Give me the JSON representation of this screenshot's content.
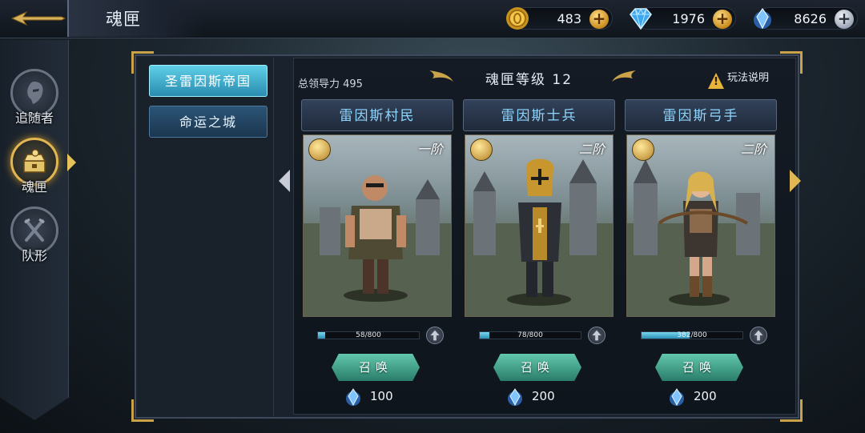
{
  "header": {
    "title": "魂匣",
    "resources": [
      {
        "icon": "gold-coin-icon",
        "value": "483"
      },
      {
        "icon": "diamond-icon",
        "value": "1976"
      },
      {
        "icon": "soul-crystal-icon",
        "value": "8626"
      }
    ]
  },
  "sidebar": {
    "items": [
      {
        "label": "追随者",
        "icon": "follower-icon",
        "active": false
      },
      {
        "label": "魂匣",
        "icon": "soul-box-icon",
        "active": true
      },
      {
        "label": "队形",
        "icon": "formation-icon",
        "active": false
      }
    ]
  },
  "categories": [
    {
      "label": "圣雷因斯帝国",
      "active": true
    },
    {
      "label": "命运之城",
      "active": false
    }
  ],
  "panel": {
    "leadership": "总领导力 495",
    "level_title": "魂匣等级 12",
    "help_label": "玩法说明"
  },
  "units": [
    {
      "name": "雷因斯村民",
      "rank": "一阶",
      "progress_text": "58/800",
      "progress": 0.0725,
      "summon_label": "召唤",
      "cost": "100"
    },
    {
      "name": "雷因斯士兵",
      "rank": "二阶",
      "progress_text": "78/800",
      "progress": 0.0975,
      "summon_label": "召唤",
      "cost": "200"
    },
    {
      "name": "雷因斯弓手",
      "rank": "二阶",
      "progress_text": "382/800",
      "progress": 0.4775,
      "summon_label": "召唤",
      "cost": "200"
    }
  ],
  "colors": {
    "accent_gold": "#e2b653",
    "active_tab": "#5fd0e8",
    "summon_button": "#3f9c86",
    "unit_name": "#8fd6ff"
  }
}
